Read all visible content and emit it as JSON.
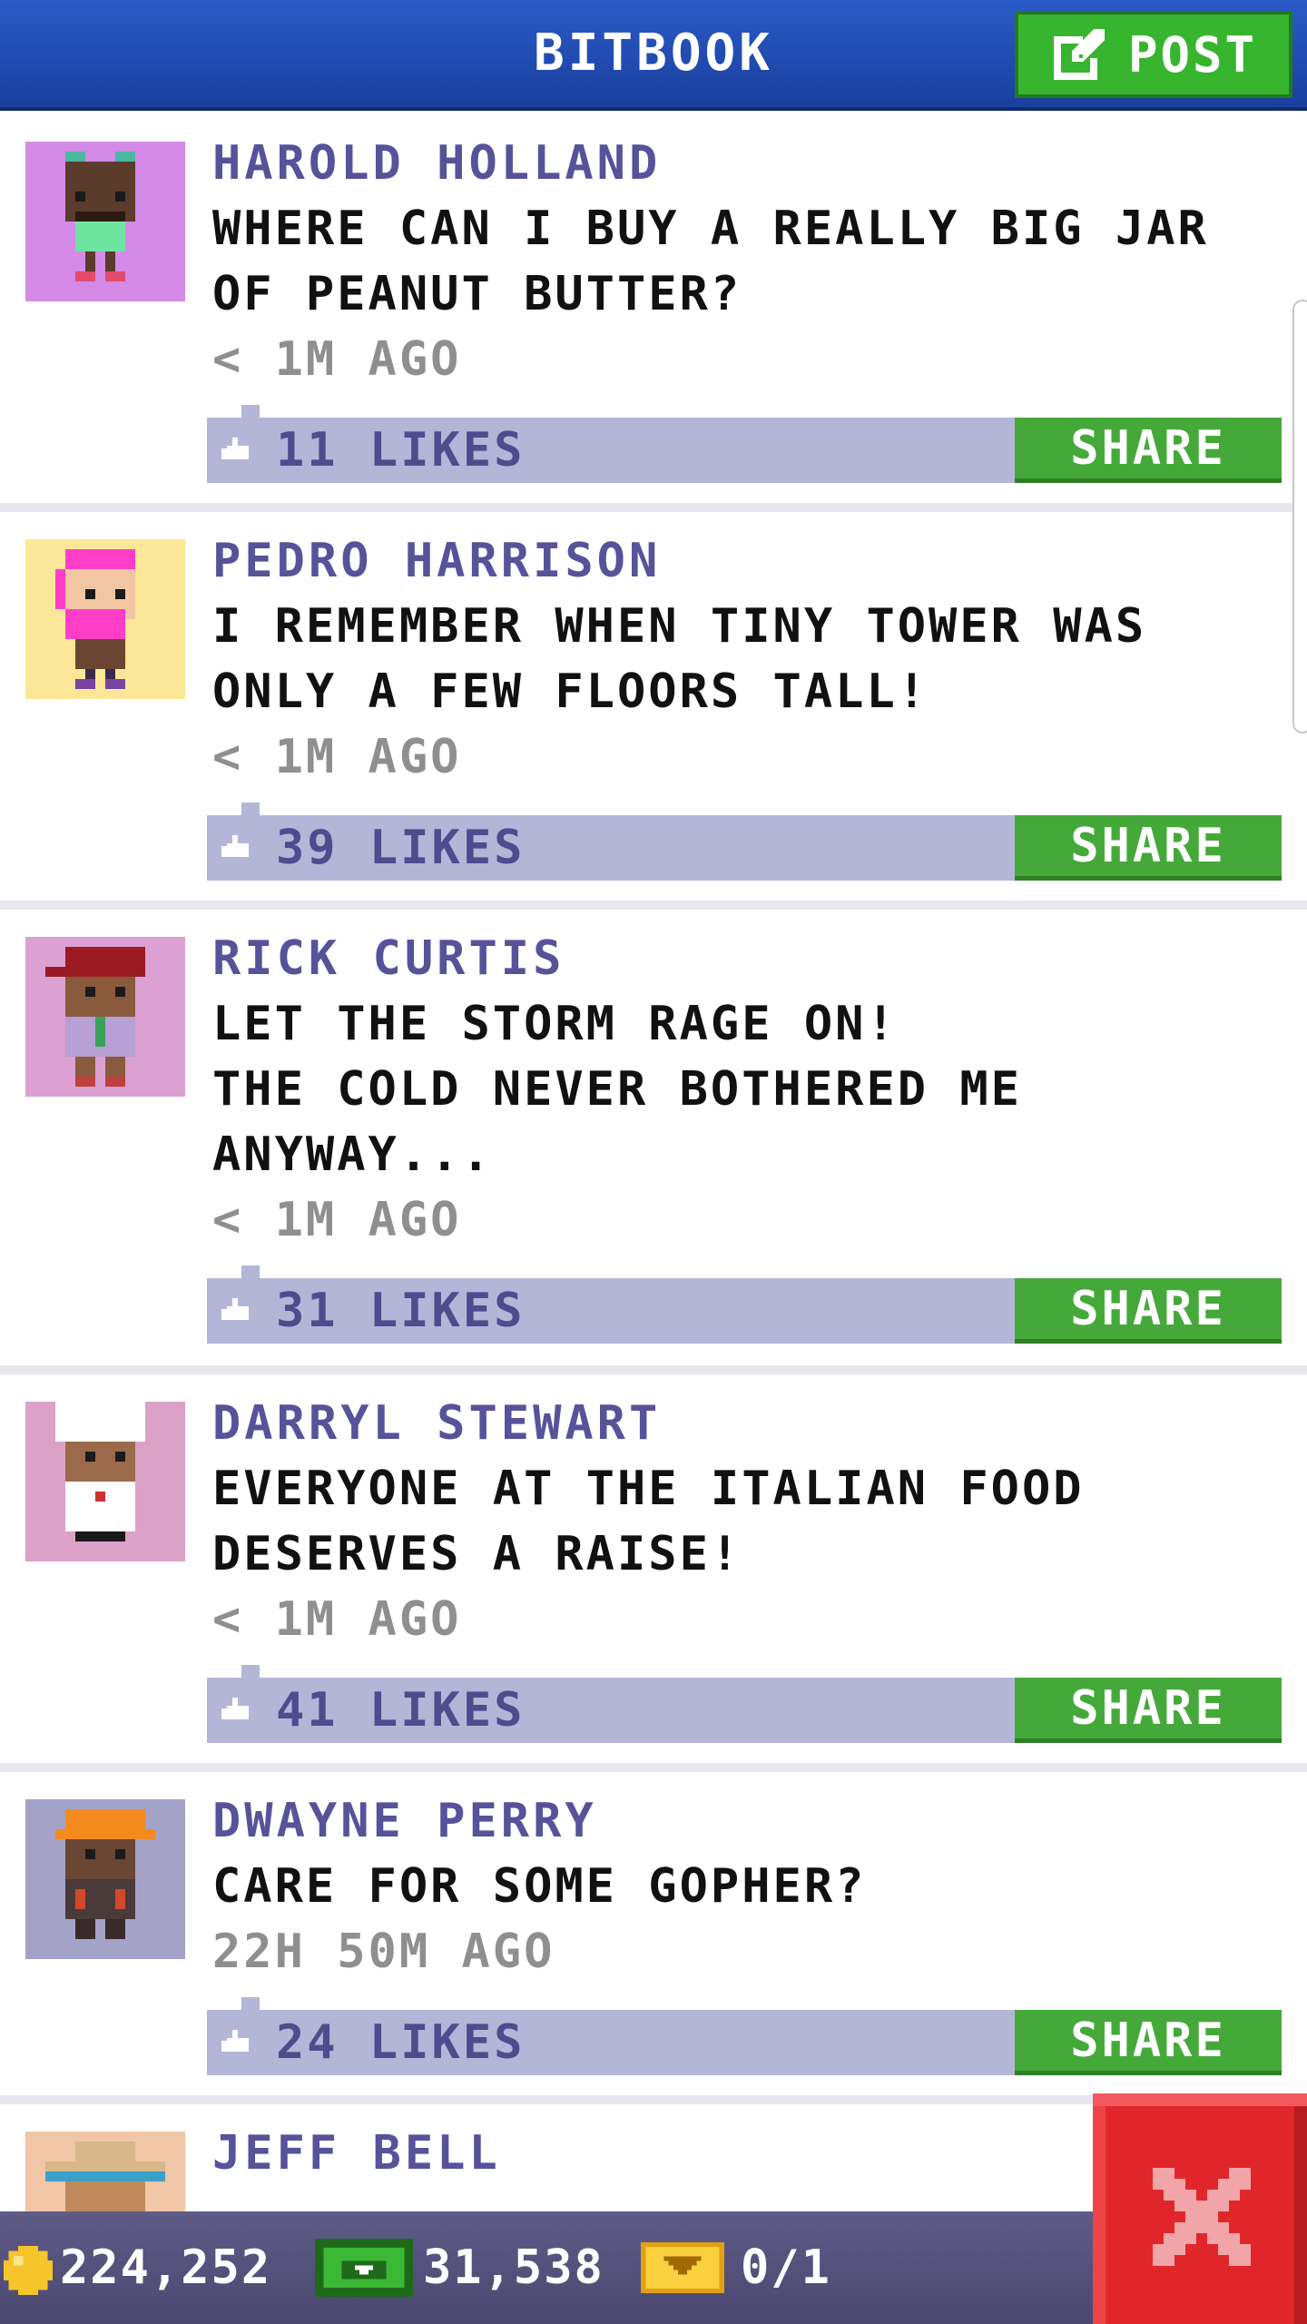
{
  "header": {
    "title": "BITBOOK",
    "post_label": "POST"
  },
  "posts": [
    {
      "author": "HAROLD HOLLAND",
      "text": "WHERE CAN I BUY A REALLY BIG JAR\nOF PEANUT BUTTER?",
      "time": "< 1M AGO",
      "likes": "11 LIKES",
      "share_label": "SHARE",
      "avatar_bg": "#d48ae6"
    },
    {
      "author": "PEDRO HARRISON",
      "text": "I REMEMBER WHEN TINY TOWER WAS\nONLY A FEW FLOORS TALL!",
      "time": "< 1M AGO",
      "likes": "39 LIKES",
      "share_label": "SHARE",
      "avatar_bg": "#fbe797"
    },
    {
      "author": "RICK CURTIS",
      "text": "LET THE STORM RAGE ON!\nTHE COLD NEVER BOTHERED ME\nANYWAY...",
      "time": "< 1M AGO",
      "likes": "31 LIKES",
      "share_label": "SHARE",
      "avatar_bg": "#dca0d2"
    },
    {
      "author": "DARRYL STEWART",
      "text": "EVERYONE AT THE ITALIAN FOOD\nDESERVES A RAISE!",
      "time": "< 1M AGO",
      "likes": "41 LIKES",
      "share_label": "SHARE",
      "avatar_bg": "#dba1c7"
    },
    {
      "author": "DWAYNE PERRY",
      "text": "CARE FOR SOME GOPHER?",
      "time": "22H 50M AGO",
      "likes": "24 LIKES",
      "share_label": "SHARE",
      "avatar_bg": "#a4a2c6"
    },
    {
      "author": "JEFF BELL",
      "avatar_bg": "#f0c6a6"
    }
  ],
  "status": {
    "coins": "224,252",
    "bux": "31,538",
    "tickets": "0/1"
  },
  "colors": {
    "header_blue": "#1a3f9e",
    "post_green": "#38b52f",
    "like_bar": "#b4b6d8",
    "author_purple": "#57529a",
    "close_red": "#e1262b"
  }
}
